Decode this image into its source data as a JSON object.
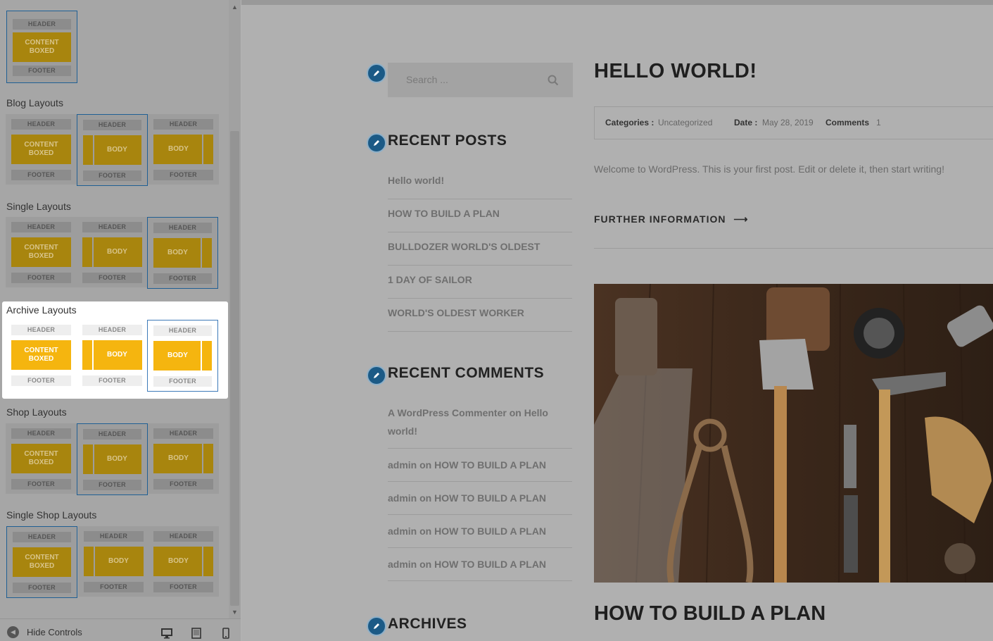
{
  "sidebar": {
    "top_partial": {
      "header": "HEADER",
      "content": "CONTENT BOXED",
      "footer": "FOOTER"
    },
    "sections": [
      {
        "title": "Blog Layouts",
        "options": [
          {
            "header": "HEADER",
            "body": "CONTENT BOXED",
            "footer": "FOOTER",
            "selected": false
          },
          {
            "header": "HEADER",
            "body": "BODY",
            "footer": "FOOTER",
            "selected": true
          },
          {
            "header": "HEADER",
            "body": "BODY",
            "footer": "FOOTER",
            "selected": false
          }
        ]
      },
      {
        "title": "Single Layouts",
        "options": [
          {
            "header": "HEADER",
            "body": "CONTENT BOXED",
            "footer": "FOOTER",
            "selected": false
          },
          {
            "header": "HEADER",
            "body": "BODY",
            "footer": "FOOTER",
            "selected": false
          },
          {
            "header": "HEADER",
            "body": "BODY",
            "footer": "FOOTER",
            "selected": true
          }
        ]
      },
      {
        "title": "Archive Layouts",
        "options": [
          {
            "header": "HEADER",
            "body": "CONTENT BOXED",
            "footer": "FOOTER",
            "selected": false
          },
          {
            "header": "HEADER",
            "body": "BODY",
            "footer": "FOOTER",
            "selected": false
          },
          {
            "header": "HEADER",
            "body": "BODY",
            "footer": "FOOTER",
            "selected": true
          }
        ]
      },
      {
        "title": "Shop Layouts",
        "options": [
          {
            "header": "HEADER",
            "body": "CONTENT BOXED",
            "footer": "FOOTER",
            "selected": false
          },
          {
            "header": "HEADER",
            "body": "BODY",
            "footer": "FOOTER",
            "selected": true
          },
          {
            "header": "HEADER",
            "body": "BODY",
            "footer": "FOOTER",
            "selected": false
          }
        ]
      },
      {
        "title": "Single Shop Layouts",
        "options": [
          {
            "header": "HEADER",
            "body": "CONTENT BOXED",
            "footer": "FOOTER",
            "selected": true
          },
          {
            "header": "HEADER",
            "body": "BODY",
            "footer": "FOOTER",
            "selected": false
          },
          {
            "header": "HEADER",
            "body": "BODY",
            "footer": "FOOTER",
            "selected": false
          }
        ]
      }
    ],
    "footer": {
      "hide_controls": "Hide Controls",
      "devices": [
        "desktop-icon",
        "tablet-icon",
        "mobile-icon"
      ]
    }
  },
  "preview": {
    "search": {
      "placeholder": "Search ..."
    },
    "recent_posts": {
      "title": "RECENT POSTS",
      "items": [
        "Hello world!",
        "HOW TO BUILD A PLAN",
        "BULLDOZER WORLD'S OLDEST",
        "1 DAY OF SAILOR",
        "WORLD'S OLDEST WORKER"
      ]
    },
    "recent_comments": {
      "title": "RECENT COMMENTS",
      "items": [
        {
          "author": "A WordPress Commenter",
          "on": "on",
          "post": "Hello world!"
        },
        {
          "author": "admin",
          "on": "on",
          "post": "HOW TO BUILD A PLAN"
        },
        {
          "author": "admin",
          "on": "on",
          "post": "HOW TO BUILD A PLAN"
        },
        {
          "author": "admin",
          "on": "on",
          "post": "HOW TO BUILD A PLAN"
        },
        {
          "author": "admin",
          "on": "on",
          "post": "HOW TO BUILD A PLAN"
        }
      ]
    },
    "archives": {
      "title": "ARCHIVES"
    },
    "post": {
      "title": "HELLO WORLD!",
      "categories_label": "Categories :",
      "categories_value": "Uncategorized",
      "date_label": "Date :",
      "date_value": "May 28, 2019",
      "comments_label": "Comments",
      "comments_value": "1",
      "excerpt": "Welcome to WordPress. This is your first post. Edit or delete it, then start writing!",
      "read_more": "FURTHER INFORMATION"
    },
    "next_post_title": "HOW TO BUILD A PLAN"
  },
  "colors": {
    "accent_selected": "#f5b50f",
    "selection_border": "#3d7ab8",
    "widget_icon": "#1b5a86"
  }
}
